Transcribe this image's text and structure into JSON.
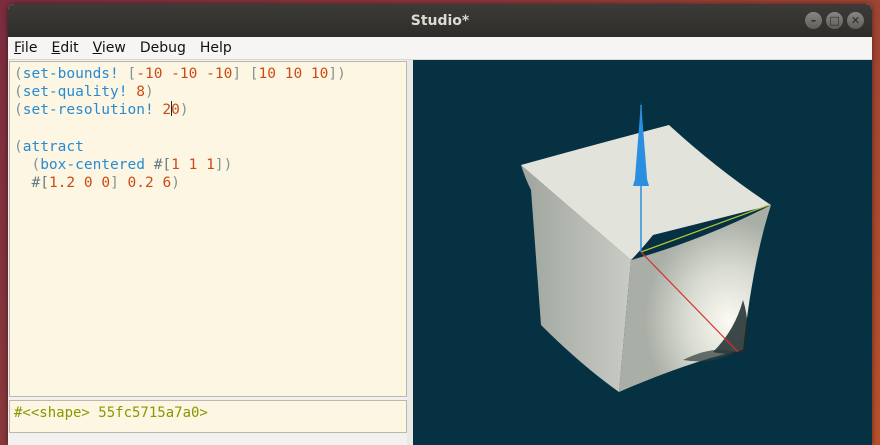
{
  "window": {
    "title": "Studio*"
  },
  "window_controls": {
    "minimize": "–",
    "maximize": "□",
    "close": "✕"
  },
  "menu": {
    "file": {
      "underline": "F",
      "rest": "ile"
    },
    "edit": {
      "underline": "E",
      "rest": "dit"
    },
    "view": {
      "underline": "V",
      "rest": "iew"
    },
    "debug": {
      "label": "Debug"
    },
    "help": {
      "label": "Help"
    }
  },
  "editor": {
    "line1": {
      "open": "(",
      "fn": "set-bounds!",
      "b1open": "[",
      "n1": "-10",
      "n2": "-10",
      "n3": "-10",
      "b1close": "]",
      "b2open": "[",
      "n4": "10",
      "n5": "10",
      "n6": "10",
      "b2close": "])"
    },
    "line2": {
      "open": "(",
      "fn": "set-quality!",
      "n": "8",
      "close": ")"
    },
    "line3": {
      "open": "(",
      "fn": "set-resolution!",
      "n_a": "2",
      "n_b": "0",
      "close": ")"
    },
    "line5": {
      "open": "(",
      "fn": "attract"
    },
    "line6": {
      "open": "(",
      "fn": "box-centered",
      "hash": "#[",
      "n1": "1",
      "n2": "1",
      "n3": "1",
      "close": "])"
    },
    "line7": {
      "hash": "#[",
      "n1": "1.2",
      "n2": "0",
      "n3": "0",
      "close": "]",
      "n4": "0.2",
      "n5": "6",
      "end": ")"
    }
  },
  "repl": {
    "output": "#<<shape> 55fc5715a7a0>"
  },
  "viewport": {
    "background": "#063143",
    "shape_color": "#e4e6de",
    "axis_x_color": "#d33030",
    "axis_y_color": "#b8c23a",
    "axis_z_color": "#2a8fe0"
  }
}
